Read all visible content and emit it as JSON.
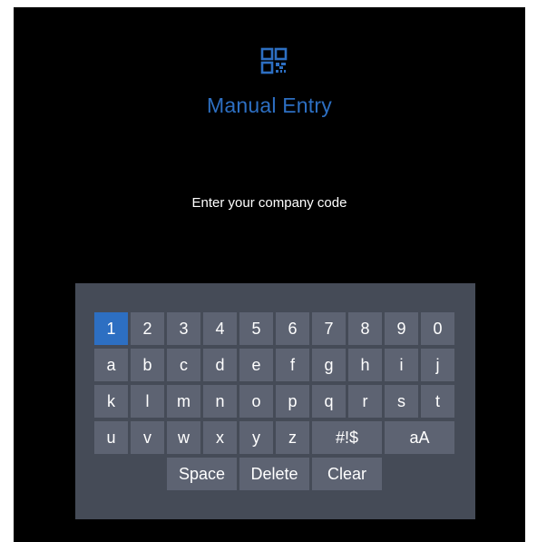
{
  "header": {
    "icon": "qr-code-icon",
    "title": "Manual Entry",
    "prompt": "Enter your company code"
  },
  "colors": {
    "accent": "#2d6fc2",
    "keyboard_bg": "#454b57",
    "key_bg": "#5d6372",
    "screen_bg": "#000000"
  },
  "keyboard": {
    "active_key": "1",
    "row1": [
      "1",
      "2",
      "3",
      "4",
      "5",
      "6",
      "7",
      "8",
      "9",
      "0"
    ],
    "row2": [
      "a",
      "b",
      "c",
      "d",
      "e",
      "f",
      "g",
      "h",
      "i",
      "j"
    ],
    "row3": [
      "k",
      "l",
      "m",
      "n",
      "o",
      "p",
      "q",
      "r",
      "s",
      "t"
    ],
    "row4": [
      "u",
      "v",
      "w",
      "x",
      "y",
      "z",
      "#!$",
      "aA"
    ],
    "row5": [
      "Space",
      "Delete",
      "Clear"
    ]
  }
}
